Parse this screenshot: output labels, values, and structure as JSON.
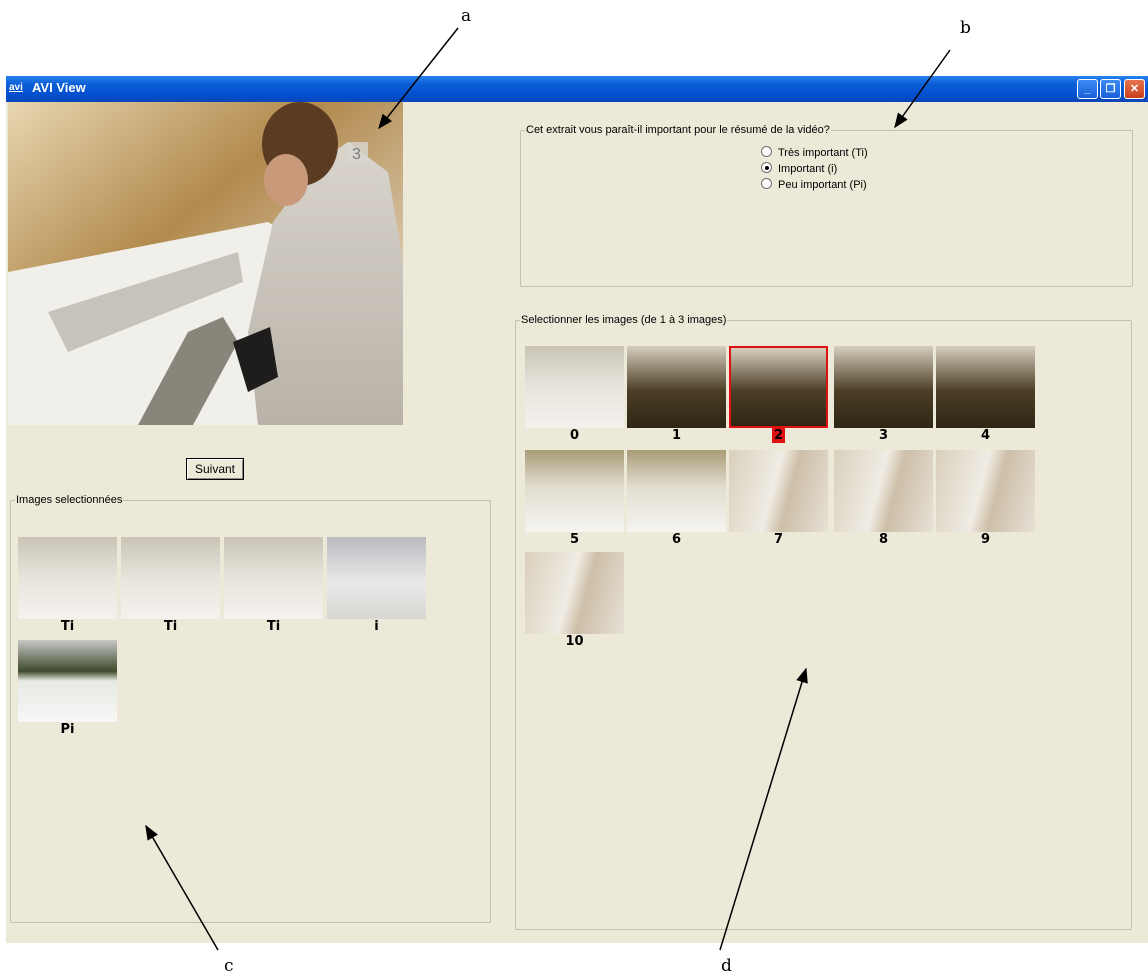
{
  "annotations": [
    "a",
    "b",
    "c",
    "d"
  ],
  "window": {
    "title": "AVI View",
    "icon_label": "avi",
    "buttons": [
      "minimize-icon",
      "restore-icon",
      "close-icon"
    ],
    "min_glyph": "_",
    "max_glyph": "❐",
    "close_glyph": "✕"
  },
  "video": {
    "channel_badge": "3"
  },
  "buttons": {
    "next_label": "Suivant"
  },
  "selected_images": {
    "legend": "Images selectionnées",
    "items": [
      {
        "label": "Ti",
        "scene": "people-ski"
      },
      {
        "label": "Ti",
        "scene": "jumper-closeup"
      },
      {
        "label": "Ti",
        "scene": "people-ski"
      },
      {
        "label": "i",
        "scene": "jumper-blue"
      },
      {
        "label": "Pi",
        "scene": "snow-forest"
      }
    ]
  },
  "question": {
    "legend": "Cet extrait vous paraît-il important pour le résumé de la vidéo?",
    "options": [
      {
        "label": "Très important (Ti)",
        "checked": false
      },
      {
        "label": "Important (i)",
        "checked": true
      },
      {
        "label": "Peu important (Pi)",
        "checked": false
      }
    ]
  },
  "image_picker": {
    "legend": "Selectionner les images (de 1 à 3 images)",
    "selected_index": 2,
    "items": [
      {
        "label": "0",
        "scene": "ski-ramp"
      },
      {
        "label": "1",
        "scene": "forest"
      },
      {
        "label": "2",
        "scene": "forest"
      },
      {
        "label": "3",
        "scene": "forest"
      },
      {
        "label": "4",
        "scene": "forest"
      },
      {
        "label": "5",
        "scene": "ramp"
      },
      {
        "label": "6",
        "scene": "ramp"
      },
      {
        "label": "7",
        "scene": "person"
      },
      {
        "label": "8",
        "scene": "person"
      },
      {
        "label": "9",
        "scene": "person"
      },
      {
        "label": "10",
        "scene": "person"
      }
    ]
  },
  "colors": {
    "titlebar": "#0450d0",
    "window_bg": "#ece9d8",
    "selection": "#e01010"
  }
}
